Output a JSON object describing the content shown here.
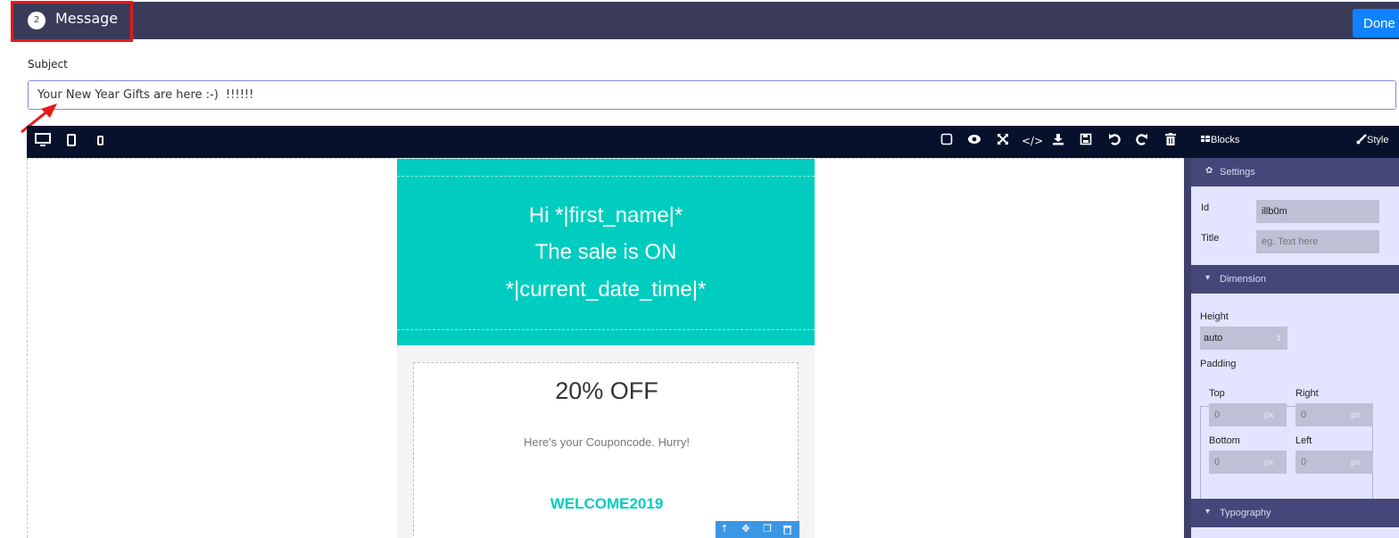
{
  "header": {
    "step_number": "2",
    "title": "Message",
    "done_label": "Done"
  },
  "subject": {
    "label": "Subject",
    "value": "Your New Year Gifts are here :-)  !!!!!!"
  },
  "editor": {
    "blocks_label": "Blocks",
    "style_label": "Style"
  },
  "email": {
    "greeting": "Hi *|first_name|*",
    "sale": "The sale is ON",
    "date": "*|current_date_time|*",
    "discount": "20% OFF",
    "coupon_text": "Here's your Couponcode. Hurry!",
    "code": "WELCOME2019"
  },
  "panel": {
    "settings_title": "Settings",
    "id_label": "Id",
    "id_value": "illb0m",
    "title_label": "Title",
    "title_placeholder": "eg. Text here",
    "dimension_title": "Dimension",
    "height_label": "Height",
    "height_value": "auto",
    "padding_label": "Padding",
    "top_label": "Top",
    "right_label": "Right",
    "bottom_label": "Bottom",
    "left_label": "Left",
    "pad_value": "0",
    "unit": "px",
    "typography_title": "Typography"
  }
}
